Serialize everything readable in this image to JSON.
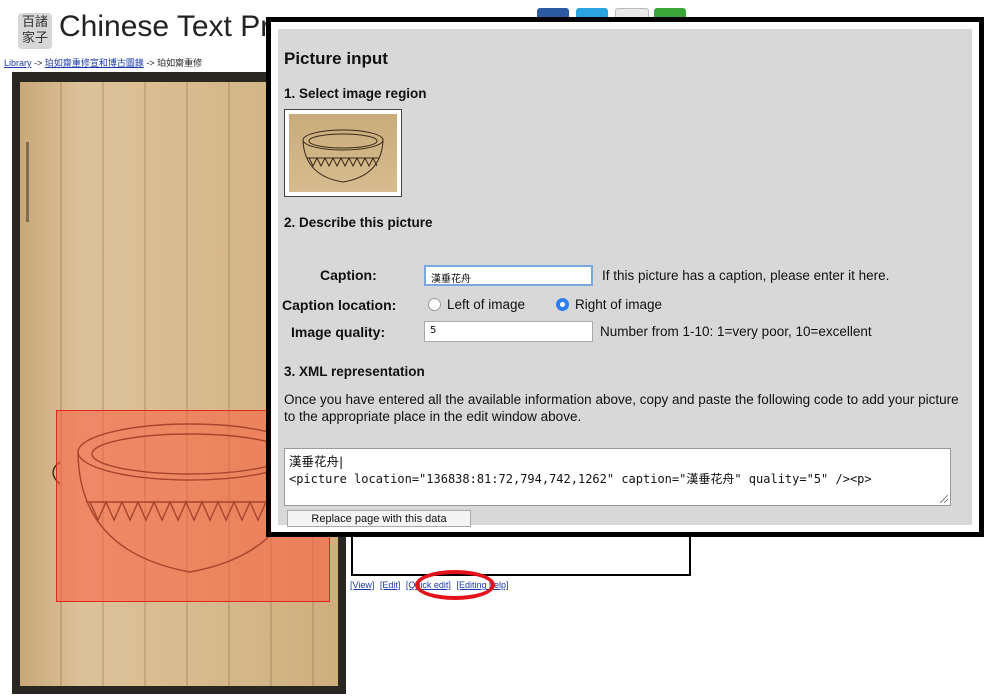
{
  "header": {
    "logo_text": "百諸\n家子",
    "site_title": "Chinese Text Pr",
    "social_colors": [
      "#2b5aa3",
      "#2aa3e0",
      "#cc2222",
      "#3aa63a"
    ]
  },
  "breadcrumb": {
    "library": "Library",
    "sep1": "->",
    "book": "珀如齋重修宣和博古圖錄",
    "sep2": "->",
    "current": "珀如齋重修"
  },
  "edit_links": {
    "view": "[View]",
    "edit": "[Edit]",
    "quick_edit": "[Quick edit]",
    "editing_help": "[Editing help]"
  },
  "dialog": {
    "title": "Picture input",
    "step1": "1. Select image region",
    "step2": "2. Describe this picture",
    "caption_label": "Caption:",
    "caption_value": "漢垂花舟",
    "caption_hint": "If this picture has a caption, please enter it here.",
    "location_label": "Caption location:",
    "location_left": "Left of image",
    "location_right": "Right of image",
    "location_selected": "Right of image",
    "quality_label": "Image quality:",
    "quality_value": "5",
    "quality_hint": "Number from 1-10: 1=very poor, 10=excellent",
    "step3": "3. XML representation",
    "xml_instructions": "Once you have entered all the available information above, copy and paste the following code to add your picture to the appropriate place in the edit window above.",
    "xml_line1": "漢垂花舟|",
    "xml_line2": "<picture location=\"136838:81:72,794,742,1262\" caption=\"漢垂花舟\" quality=\"5\" /><p>",
    "replace_button": "Replace page with this data"
  },
  "colors": {
    "selection": "#ff5a3c",
    "highlight_oval": "#e3121b",
    "radio_checked": "#2f7df0",
    "dialog_bg": "#d8d8d8"
  }
}
